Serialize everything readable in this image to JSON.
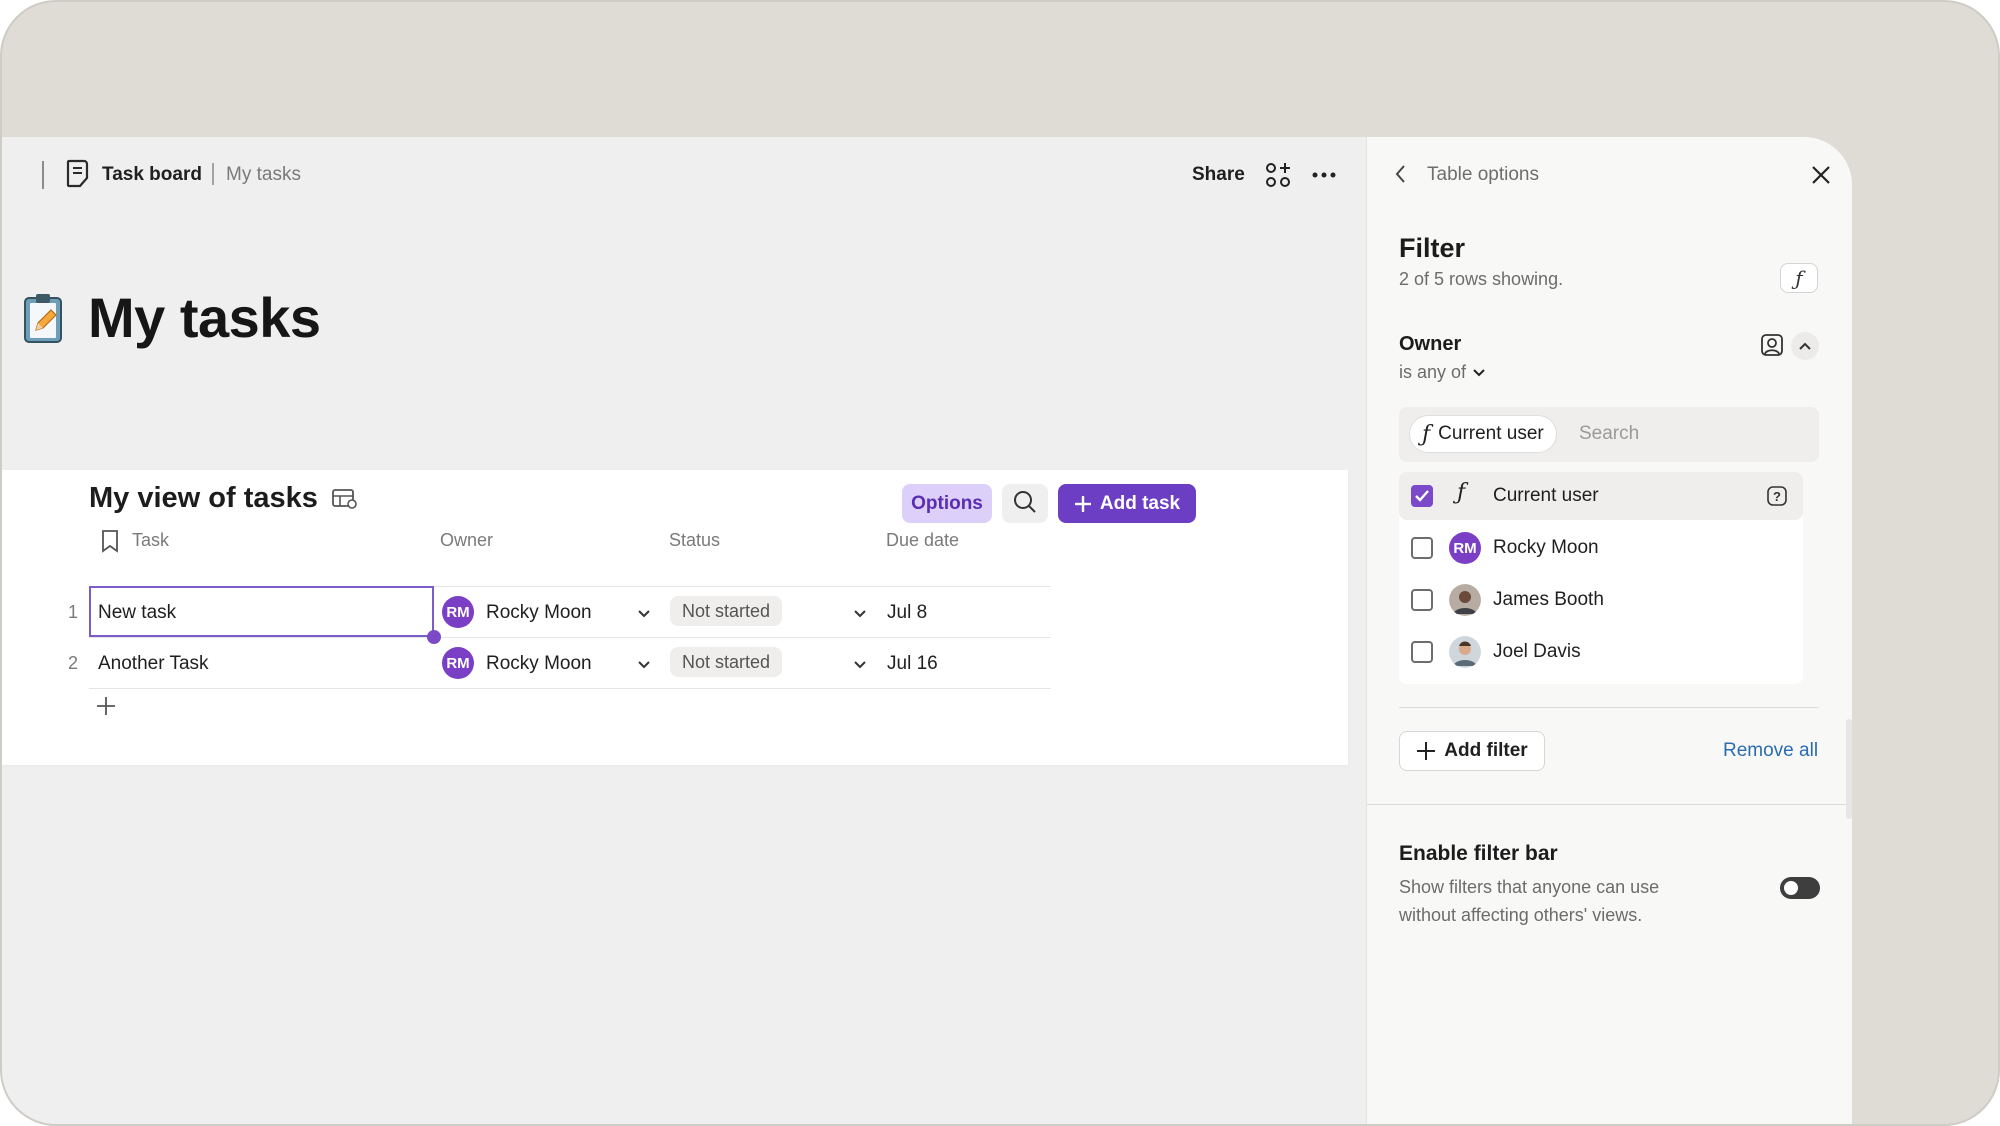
{
  "breadcrumb": {
    "main": "Task board",
    "sub": "My tasks"
  },
  "header": {
    "share_label": "Share"
  },
  "page": {
    "title": "My tasks"
  },
  "view": {
    "title": "My view of tasks",
    "options_label": "Options",
    "add_task_label": "Add task",
    "columns": {
      "task": "Task",
      "owner": "Owner",
      "status": "Status",
      "due": "Due date"
    },
    "rows": [
      {
        "num": "1",
        "task": "New task",
        "owner_initials": "RM",
        "owner": "Rocky Moon",
        "status": "Not started",
        "due": "Jul 8"
      },
      {
        "num": "2",
        "task": "Another Task",
        "owner_initials": "RM",
        "owner": "Rocky Moon",
        "status": "Not started",
        "due": "Jul 16"
      }
    ]
  },
  "panel": {
    "header": "Table options",
    "filter_title": "Filter",
    "filter_sub": "2 of 5 rows showing.",
    "owner_label": "Owner",
    "operator": "is any of",
    "chip_label": "Current user",
    "search_placeholder": "Search",
    "options": [
      {
        "label": "Current user",
        "checked": true
      },
      {
        "label": "Rocky Moon",
        "initials": "RM",
        "checked": false
      },
      {
        "label": "James Booth",
        "checked": false
      },
      {
        "label": "Joel Davis",
        "checked": false
      }
    ],
    "add_filter_label": "Add filter",
    "remove_all_label": "Remove all",
    "enable_title": "Enable filter bar",
    "enable_desc": "Show filters that anyone can use without affecting others' views.",
    "enable_on": false
  },
  "colors": {
    "accent": "#6b3ec4",
    "options_bg": "#dccffa",
    "link": "#2b6cb0",
    "avatar_rm": "#7a3fc4"
  }
}
